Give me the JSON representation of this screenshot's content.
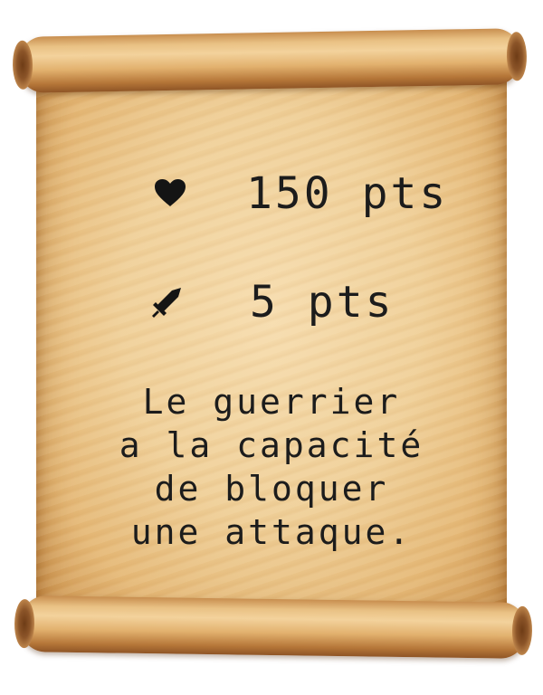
{
  "card": {
    "stats": {
      "health": {
        "icon": "heart-icon",
        "value": "150 pts"
      },
      "attack": {
        "icon": "sword-icon",
        "value": "5 pts"
      }
    },
    "description_lines": [
      "Le guerrier",
      "a la capacité",
      "de bloquer",
      "une attaque."
    ]
  },
  "colors": {
    "text": "#1c1c1c",
    "parchment": "#efcf98"
  }
}
